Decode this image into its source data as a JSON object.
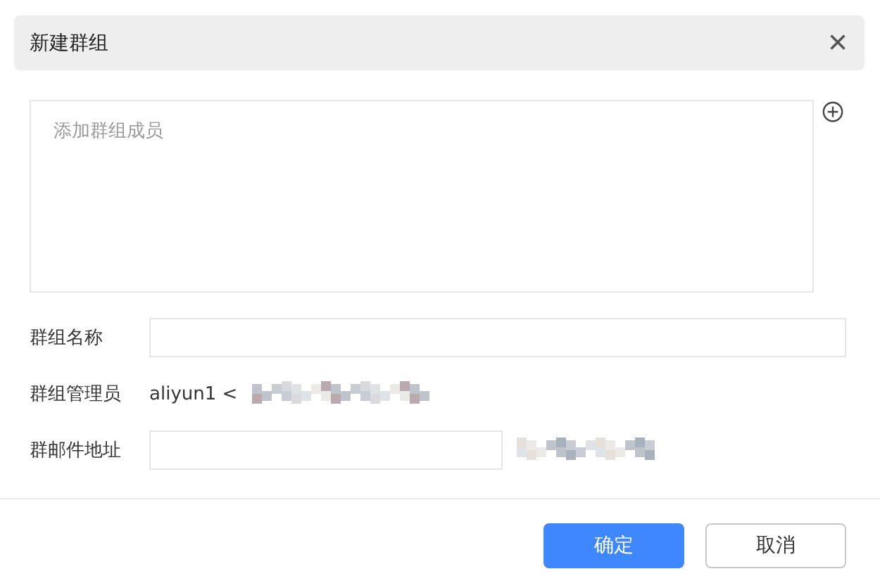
{
  "dialog": {
    "title": "新建群组",
    "close": "×"
  },
  "members": {
    "placeholder": "添加群组成员"
  },
  "form": [
    {
      "kind": "input",
      "label": "群组名称"
    },
    {
      "kind": "text",
      "label": "群组管理员",
      "value": "aliyun1 <"
    },
    {
      "kind": "input-short",
      "label": "群邮件地址"
    }
  ],
  "buttons": [
    {
      "label": "确定",
      "primary": true
    },
    {
      "label": "取消",
      "primary": false
    }
  ]
}
